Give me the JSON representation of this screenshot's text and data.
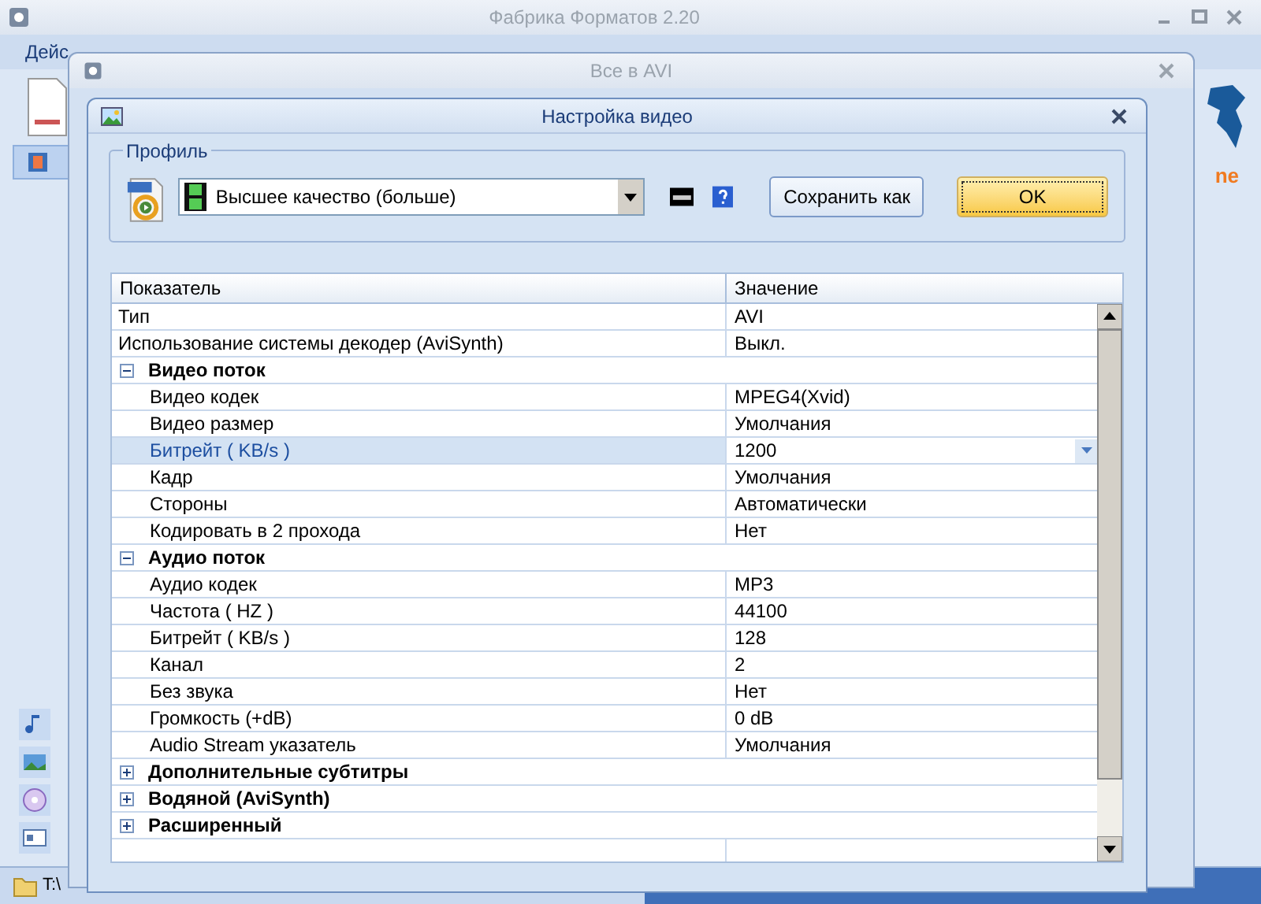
{
  "main_window": {
    "title": "Фабрика Форматов 2.20",
    "menu": [
      "Дейс"
    ],
    "logo_text": "ne",
    "status_bar": {
      "path": "T:\\"
    }
  },
  "convert_window": {
    "title": "Все в AVI"
  },
  "dialog": {
    "title": "Настройка видео",
    "profile": {
      "label": "Профиль",
      "value": "Высшее качество (больше)",
      "save_button": "Сохранить как",
      "ok_button": "OK"
    },
    "grid": {
      "columns": [
        "Показатель",
        "Значение"
      ],
      "rows": [
        {
          "kind": "row",
          "name": "Тип",
          "value": "AVI",
          "selected": false
        },
        {
          "kind": "row",
          "name": "Использование системы декодер (AviSynth)",
          "value": "Выкл.",
          "selected": false
        },
        {
          "kind": "group",
          "name": "Видео поток",
          "expanded": true,
          "children": [
            {
              "kind": "row",
              "name": "Видео кодек",
              "value": "MPEG4(Xvid)",
              "selected": false
            },
            {
              "kind": "row",
              "name": "Видео размер",
              "value": "Умолчания",
              "selected": false
            },
            {
              "kind": "row",
              "name": "Битрейт ( KB/s )",
              "value": "1200",
              "selected": true
            },
            {
              "kind": "row",
              "name": "Кадр",
              "value": "Умолчания",
              "selected": false
            },
            {
              "kind": "row",
              "name": "Стороны",
              "value": "Автоматически",
              "selected": false
            },
            {
              "kind": "row",
              "name": "Кодировать в 2 прохода",
              "value": "Нет",
              "selected": false
            }
          ]
        },
        {
          "kind": "group",
          "name": "Аудио поток",
          "expanded": true,
          "children": [
            {
              "kind": "row",
              "name": "Аудио кодек",
              "value": "MP3",
              "selected": false
            },
            {
              "kind": "row",
              "name": "Частота ( HZ )",
              "value": "44100",
              "selected": false
            },
            {
              "kind": "row",
              "name": "Битрейт ( KB/s )",
              "value": "128",
              "selected": false
            },
            {
              "kind": "row",
              "name": "Канал",
              "value": "2",
              "selected": false
            },
            {
              "kind": "row",
              "name": "Без звука",
              "value": "Нет",
              "selected": false
            },
            {
              "kind": "row",
              "name": "Громкость (+dB)",
              "value": "0 dB",
              "selected": false
            },
            {
              "kind": "row",
              "name": "Audio Stream указатель",
              "value": "Умолчания",
              "selected": false
            }
          ]
        },
        {
          "kind": "group",
          "name": "Дополнительные субтитры",
          "expanded": false
        },
        {
          "kind": "group",
          "name": "Водяной (AviSynth)",
          "expanded": false
        },
        {
          "kind": "group",
          "name": "Расширенный",
          "expanded": false
        }
      ]
    }
  }
}
